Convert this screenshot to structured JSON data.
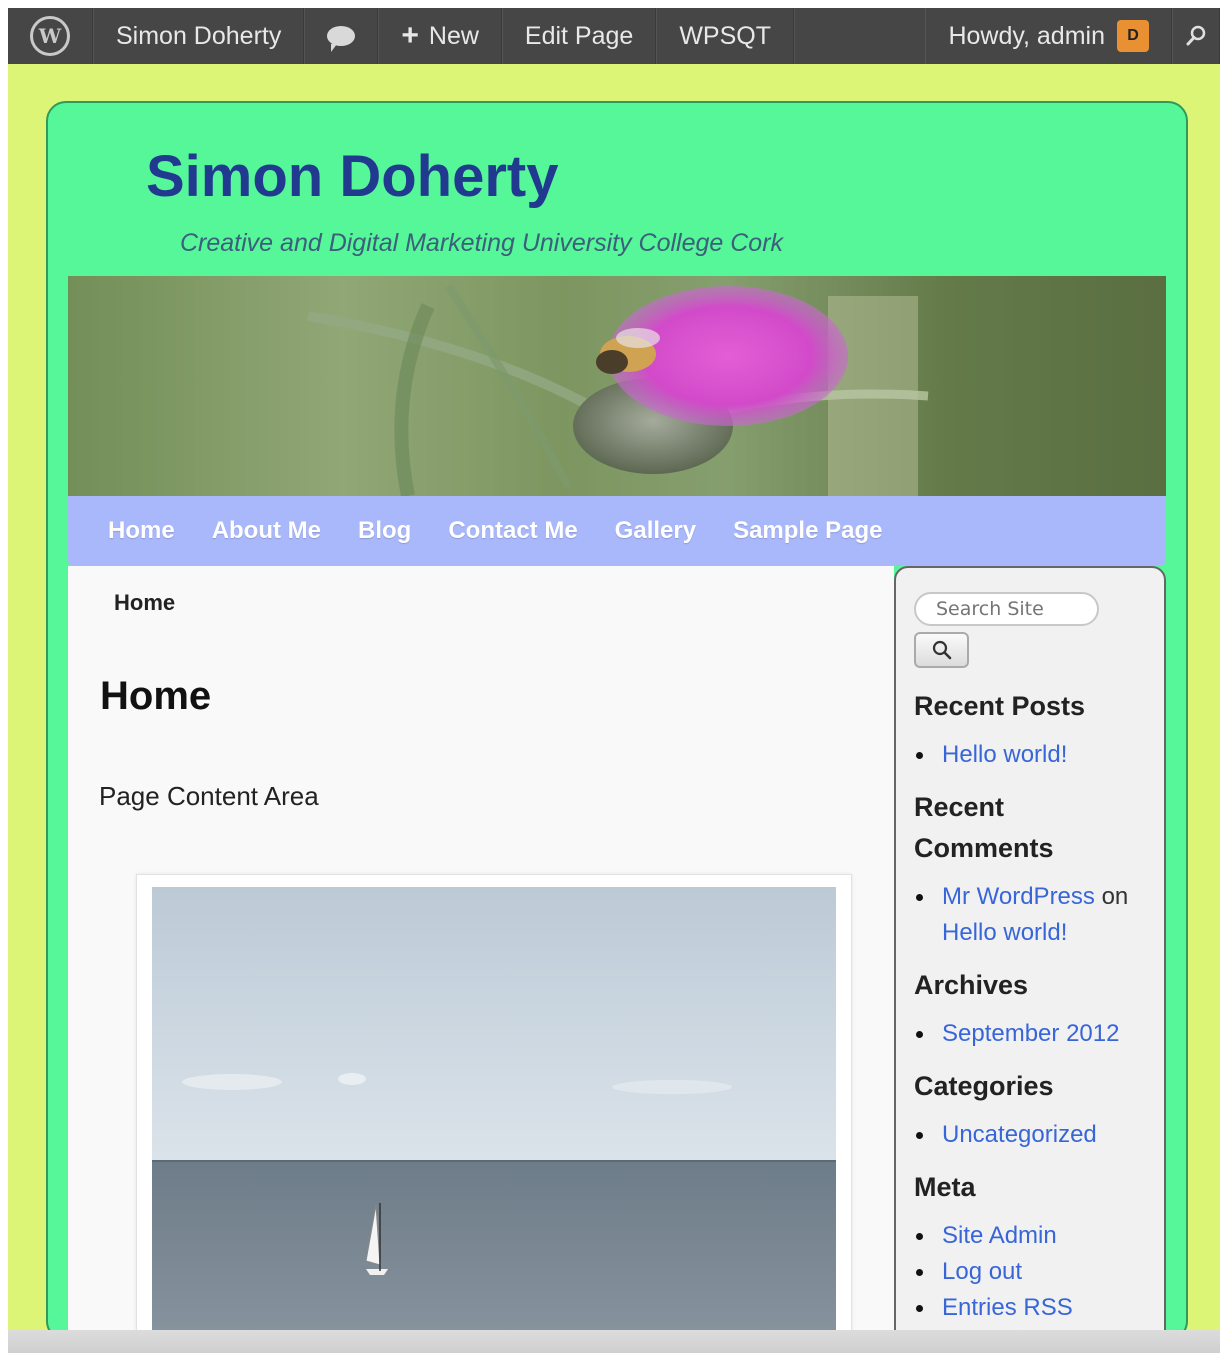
{
  "adminbar": {
    "site_name": "Simon Doherty",
    "new_label": "New",
    "edit_page": "Edit Page",
    "plugin": "WPSQT",
    "howdy": "Howdy, admin"
  },
  "site": {
    "title": "Simon Doherty",
    "tagline": "Creative and Digital Marketing University College Cork"
  },
  "nav": {
    "items": [
      "Home",
      "About Me",
      "Blog",
      "Contact Me",
      "Gallery",
      "Sample Page"
    ]
  },
  "content": {
    "breadcrumb": "Home",
    "title": "Home",
    "text": "Page Content Area"
  },
  "sidebar": {
    "search_placeholder": "Search Site",
    "recent_posts_title": "Recent Posts",
    "recent_posts": [
      "Hello world!"
    ],
    "recent_comments_title_1": "Recent",
    "recent_comments_title_2": "Comments",
    "comment_author": "Mr WordPress",
    "comment_on": " on ",
    "comment_post": "Hello world!",
    "archives_title": "Archives",
    "archives": [
      "September 2012"
    ],
    "categories_title": "Categories",
    "categories": [
      "Uncategorized"
    ],
    "meta_title": "Meta",
    "meta": [
      "Site Admin",
      "Log out",
      "Entries RSS"
    ]
  },
  "colors": {
    "page_background": "#ddf577",
    "site_background": "#55f799",
    "title_color": "#213a8f",
    "nav_background": "#a9b7fb",
    "link_color": "#3866d8"
  }
}
